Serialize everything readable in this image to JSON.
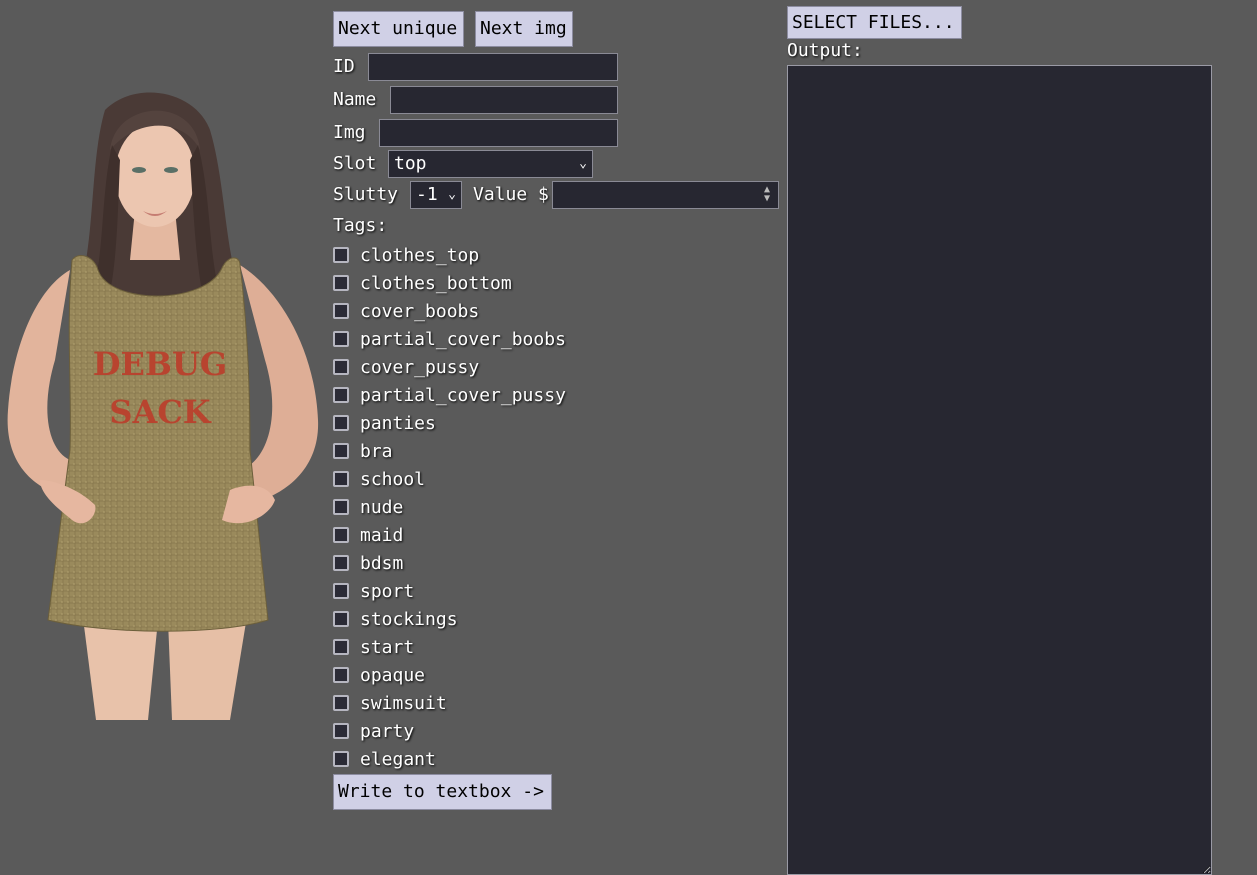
{
  "buttons": {
    "next_unique": "Next unique",
    "next_img": "Next img",
    "select_files": "SELECT FILES...",
    "write": "Write to textbox ->"
  },
  "form": {
    "id_label": "ID",
    "id_value": "",
    "name_label": "Name",
    "name_value": "",
    "img_label": "Img",
    "img_value": "",
    "slot_label": "Slot",
    "slot_value": "top",
    "slutty_label": "Slutty",
    "slutty_value": "-1",
    "value_label": "Value $",
    "value_value": "",
    "tags_label": "Tags:"
  },
  "tags": [
    {
      "label": "clothes_top",
      "checked": false
    },
    {
      "label": "clothes_bottom",
      "checked": false
    },
    {
      "label": "cover_boobs",
      "checked": false
    },
    {
      "label": "partial_cover_boobs",
      "checked": false
    },
    {
      "label": "cover_pussy",
      "checked": false
    },
    {
      "label": "partial_cover_pussy",
      "checked": false
    },
    {
      "label": "panties",
      "checked": false
    },
    {
      "label": "bra",
      "checked": false
    },
    {
      "label": "school",
      "checked": false
    },
    {
      "label": "nude",
      "checked": false
    },
    {
      "label": "maid",
      "checked": false
    },
    {
      "label": "bdsm",
      "checked": false
    },
    {
      "label": "sport",
      "checked": false
    },
    {
      "label": "stockings",
      "checked": false
    },
    {
      "label": "start",
      "checked": false
    },
    {
      "label": "opaque",
      "checked": false
    },
    {
      "label": "swimsuit",
      "checked": false
    },
    {
      "label": "party",
      "checked": false
    },
    {
      "label": "elegant",
      "checked": false
    }
  ],
  "output": {
    "label": "Output:",
    "value": ""
  },
  "preview": {
    "text_line1": "DEBUG",
    "text_line2": "SACK"
  }
}
